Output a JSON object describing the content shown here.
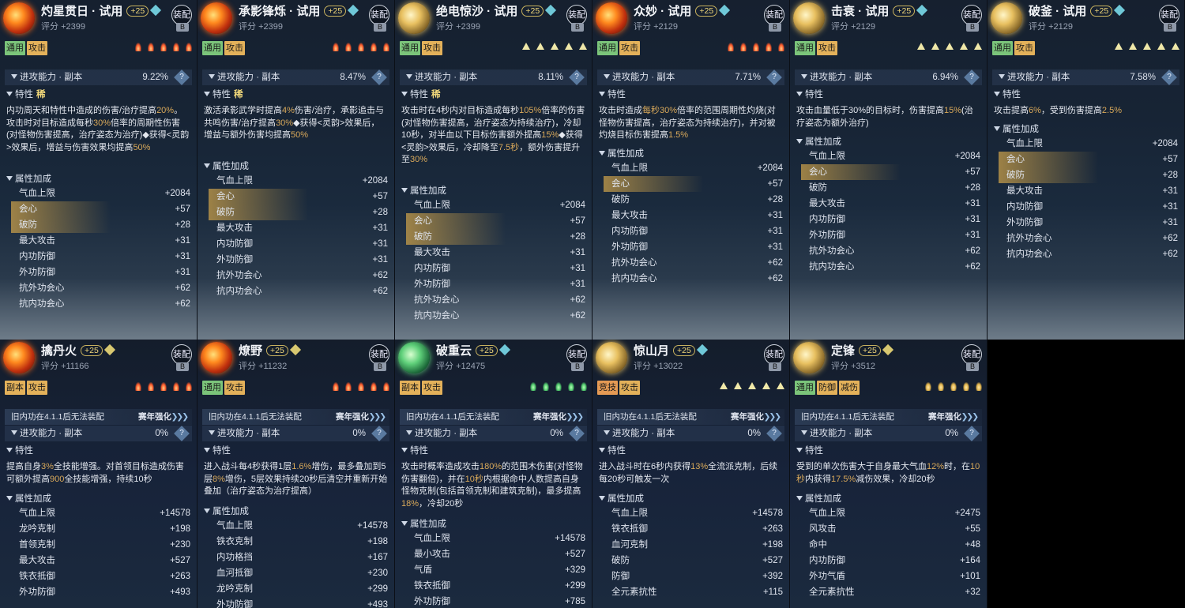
{
  "header_common": {
    "score_prefix": "评分 ",
    "equip": "装配",
    "equip_badge": "B",
    "ability_label": "进攻能力 · 副本",
    "trait_label": "特性",
    "attr_label": "属性加成",
    "question": "?"
  },
  "cards": [
    {
      "title": "灼星贯日 · 试用",
      "level": "+25",
      "score": "+2399",
      "tags": [
        "通用",
        "攻击"
      ],
      "glyph": "fire",
      "ability_pct": "9.22%",
      "rarity": "稀",
      "desc": [
        [
          "内功周天和特性中造成的伤害/治疗提高",
          ""
        ],
        [
          "20%",
          "hl"
        ],
        [
          "。攻击时对目标造成每秒",
          ""
        ],
        [
          "30%",
          "hl"
        ],
        [
          "倍率的周期性伤害(对怪物伤害提高，治疗姿态为治疗)",
          ""
        ],
        [
          "◆获得<灵韵>效果后，增益与伤害效果均提高",
          ""
        ],
        [
          "50%",
          "hl"
        ]
      ],
      "stats": [
        [
          "气血上限",
          "+2084",
          0
        ],
        [
          "会心",
          "+57",
          1
        ],
        [
          "破防",
          "+28",
          1
        ],
        [
          "最大攻击",
          "+31",
          0
        ],
        [
          "内功防御",
          "+31",
          0
        ],
        [
          "外功防御",
          "+31",
          0
        ],
        [
          "抗外功会心",
          "+62",
          0
        ],
        [
          "抗内功会心",
          "+62",
          0
        ]
      ]
    },
    {
      "title": "承影锋烁 · 试用",
      "level": "+25",
      "score": "+2399",
      "tags": [
        "通用",
        "攻击"
      ],
      "glyph": "fire",
      "ability_pct": "8.47%",
      "rarity": "稀",
      "desc": [
        [
          "激活承影武学时提高",
          ""
        ],
        [
          "4%",
          "hl"
        ],
        [
          "伤害/治疗，承影追击与共鸣伤害/治疗提高",
          ""
        ],
        [
          "30%",
          "hl"
        ],
        [
          "◆获得<灵韵>效果后，增益与额外伤害均提高",
          ""
        ],
        [
          "50%",
          "hl"
        ]
      ],
      "stats": [
        [
          "气血上限",
          "+2084",
          0
        ],
        [
          "会心",
          "+57",
          1
        ],
        [
          "破防",
          "+28",
          1
        ],
        [
          "最大攻击",
          "+31",
          0
        ],
        [
          "内功防御",
          "+31",
          0
        ],
        [
          "外功防御",
          "+31",
          0
        ],
        [
          "抗外功会心",
          "+62",
          0
        ],
        [
          "抗内功会心",
          "+62",
          0
        ]
      ]
    },
    {
      "title": "绝电惊沙 · 试用",
      "level": "+25",
      "score": "+2399",
      "tags": [
        "通用",
        "攻击"
      ],
      "glyph": "tri",
      "ability_pct": "8.11%",
      "rarity": "稀",
      "desc": [
        [
          "攻击时在4秒内对目标造成每秒",
          ""
        ],
        [
          "105%",
          "hl"
        ],
        [
          "倍率的伤害(对怪物伤害提高，治疗姿态为持续治疗)，冷却10秒，对半血以下目标伤害额外提高",
          ""
        ],
        [
          "15%",
          "hl"
        ],
        [
          "◆获得<灵韵>效果后，冷却降至",
          ""
        ],
        [
          "7.5秒",
          "hl"
        ],
        [
          "，额外伤害提升至",
          ""
        ],
        [
          "30%",
          "hl"
        ]
      ],
      "stats": [
        [
          "气血上限",
          "+2084",
          0
        ],
        [
          "会心",
          "+57",
          1
        ],
        [
          "破防",
          "+28",
          1
        ],
        [
          "最大攻击",
          "+31",
          0
        ],
        [
          "内功防御",
          "+31",
          0
        ],
        [
          "外功防御",
          "+31",
          0
        ],
        [
          "抗外功会心",
          "+62",
          0
        ],
        [
          "抗内功会心",
          "+62",
          0
        ]
      ]
    },
    {
      "title": "众妙 · 试用",
      "level": "+25",
      "score": "+2129",
      "tags": [
        "通用",
        "攻击"
      ],
      "glyph": "fire",
      "ability_pct": "7.71%",
      "rarity": "",
      "desc": [
        [
          "攻击时造成",
          ""
        ],
        [
          "每秒30%",
          "hl"
        ],
        [
          "倍率的范围周期性灼烧(对怪物伤害提高，治疗姿态为持续治疗)，并对被灼烧目标伤害提高",
          ""
        ],
        [
          "1.5%",
          "hl"
        ]
      ],
      "stats": [
        [
          "气血上限",
          "+2084",
          0
        ],
        [
          "会心",
          "+57",
          1
        ],
        [
          "破防",
          "+28",
          0
        ],
        [
          "最大攻击",
          "+31",
          0
        ],
        [
          "内功防御",
          "+31",
          0
        ],
        [
          "外功防御",
          "+31",
          0
        ],
        [
          "抗外功会心",
          "+62",
          0
        ],
        [
          "抗内功会心",
          "+62",
          0
        ]
      ]
    },
    {
      "title": "击衰 · 试用",
      "level": "+25",
      "score": "+2129",
      "tags": [
        "通用",
        "攻击"
      ],
      "glyph": "tri",
      "ability_pct": "6.94%",
      "rarity": "",
      "desc": [
        [
          "攻击血量低于30%的目标时，伤害提高",
          ""
        ],
        [
          "15%",
          "hl"
        ],
        [
          "(治疗姿态为额外治疗)",
          ""
        ]
      ],
      "stats": [
        [
          "气血上限",
          "+2084",
          0
        ],
        [
          "会心",
          "+57",
          1
        ],
        [
          "破防",
          "+28",
          0
        ],
        [
          "最大攻击",
          "+31",
          0
        ],
        [
          "内功防御",
          "+31",
          0
        ],
        [
          "外功防御",
          "+31",
          0
        ],
        [
          "抗外功会心",
          "+62",
          0
        ],
        [
          "抗内功会心",
          "+62",
          0
        ]
      ]
    },
    {
      "title": "破釜 · 试用",
      "level": "+25",
      "score": "+2129",
      "tags": [
        "通用",
        "攻击"
      ],
      "glyph": "tri",
      "ability_pct": "7.58%",
      "rarity": "",
      "desc": [
        [
          "攻击提高",
          ""
        ],
        [
          "6%",
          "hl"
        ],
        [
          "，受到伤害提高",
          ""
        ],
        [
          "2.5%",
          "hl"
        ]
      ],
      "stats": [
        [
          "气血上限",
          "+2084",
          0
        ],
        [
          "会心",
          "+57",
          1
        ],
        [
          "破防",
          "+28",
          1
        ],
        [
          "最大攻击",
          "+31",
          0
        ],
        [
          "内功防御",
          "+31",
          0
        ],
        [
          "外功防御",
          "+31",
          0
        ],
        [
          "抗外功会心",
          "+62",
          0
        ],
        [
          "抗内功会心",
          "+62",
          0
        ]
      ]
    },
    {
      "title": "擒丹火",
      "level": "+25",
      "score": "+11166",
      "tags": [
        "副本",
        "攻击"
      ],
      "glyph": "fire",
      "ability_pct": "0%",
      "lock": "旧内功在4.1.1后无法装配",
      "season": "赛年强化",
      "desc": [
        [
          "提高自身",
          ""
        ],
        [
          "3%",
          "hl"
        ],
        [
          "全技能增强。对首领目标造成伤害可额外提高",
          ""
        ],
        [
          "900",
          "hl"
        ],
        [
          "全技能增强，持续10秒",
          ""
        ]
      ],
      "stats": [
        [
          "气血上限",
          "+14578",
          0
        ],
        [
          "龙吟克制",
          "+198",
          0
        ],
        [
          "首领克制",
          "+230",
          0
        ],
        [
          "最大攻击",
          "+527",
          0
        ],
        [
          "铁衣抵御",
          "+263",
          0
        ],
        [
          "外功防御",
          "+493",
          0
        ]
      ]
    },
    {
      "title": "燎野",
      "level": "+25",
      "score": "+11232",
      "tags": [
        "通用",
        "攻击"
      ],
      "glyph": "fire",
      "ability_pct": "0%",
      "lock": "旧内功在4.1.1后无法装配",
      "season": "赛年强化",
      "desc": [
        [
          "进入战斗每4秒获得1层",
          ""
        ],
        [
          "1.6%",
          "hl"
        ],
        [
          "增伤，最多叠加到5层",
          ""
        ],
        [
          "8%",
          "hl"
        ],
        [
          "增伤，5层效果持续20秒后清空并重新开始叠加（治疗姿态为治疗提高）",
          ""
        ]
      ],
      "stats": [
        [
          "气血上限",
          "+14578",
          0
        ],
        [
          "铁衣克制",
          "+198",
          0
        ],
        [
          "内功格挡",
          "+167",
          0
        ],
        [
          "血河抵御",
          "+230",
          0
        ],
        [
          "龙吟克制",
          "+299",
          0
        ],
        [
          "外功防御",
          "+493",
          0
        ]
      ]
    },
    {
      "title": "破重云",
      "level": "+25",
      "score": "+12475",
      "tags": [
        "副本",
        "攻击"
      ],
      "glyph": "leaf",
      "ability_pct": "0%",
      "lock": "旧内功在4.1.1后无法装配",
      "season": "赛年强化",
      "desc": [
        [
          "攻击时概率造成攻击",
          ""
        ],
        [
          "180%",
          "hl"
        ],
        [
          "的范围木伤害(对怪物伤害翻倍)，并在",
          ""
        ],
        [
          "10秒",
          "hl"
        ],
        [
          "内根据命中人数提高自身怪物克制(包括首领克制和建筑克制)，最多提高",
          ""
        ],
        [
          "18%",
          "hl"
        ],
        [
          "，冷却20秒",
          ""
        ]
      ],
      "stats": [
        [
          "气血上限",
          "+14578",
          0
        ],
        [
          "最小攻击",
          "+527",
          0
        ],
        [
          "气盾",
          "+329",
          0
        ],
        [
          "铁衣抵御",
          "+299",
          0
        ],
        [
          "外功防御",
          "+785",
          0
        ]
      ]
    },
    {
      "title": "惊山月",
      "level": "+25",
      "score": "+13022",
      "tags": [
        "竞技",
        "攻击"
      ],
      "glyph": "tri",
      "ability_pct": "0%",
      "lock": "旧内功在4.1.1后无法装配",
      "season": "赛年强化",
      "desc": [
        [
          "进入战斗时在6秒内获得",
          ""
        ],
        [
          "13%",
          "hl"
        ],
        [
          "全流派克制，后续每20秒可触发一次",
          ""
        ]
      ],
      "stats": [
        [
          "气血上限",
          "+14578",
          0
        ],
        [
          "铁衣抵御",
          "+263",
          0
        ],
        [
          "血河克制",
          "+198",
          0
        ],
        [
          "破防",
          "+527",
          0
        ],
        [
          "防御",
          "+392",
          0
        ],
        [
          "全元素抗性",
          "+115",
          0
        ]
      ]
    },
    {
      "title": "定锋",
      "level": "+25",
      "score": "+3512",
      "tags": [
        "通用",
        "防御",
        "减伤"
      ],
      "glyph": "bell",
      "ability_pct": "0%",
      "lock": "旧内功在4.1.1后无法装配",
      "season": "赛年强化",
      "desc": [
        [
          "受到的单次伤害大于自身最大气血",
          ""
        ],
        [
          "12%",
          "hl"
        ],
        [
          "时，在",
          ""
        ],
        [
          "10秒",
          "hl"
        ],
        [
          "内获得",
          ""
        ],
        [
          "17.5%",
          "hl"
        ],
        [
          "减伤效果，冷却20秒",
          ""
        ]
      ],
      "stats": [
        [
          "气血上限",
          "+2475",
          0
        ],
        [
          "风攻击",
          "+55",
          0
        ],
        [
          "命中",
          "+48",
          0
        ],
        [
          "内功防御",
          "+164",
          0
        ],
        [
          "外功气盾",
          "+101",
          0
        ],
        [
          "全元素抗性",
          "+32",
          0
        ]
      ]
    }
  ]
}
